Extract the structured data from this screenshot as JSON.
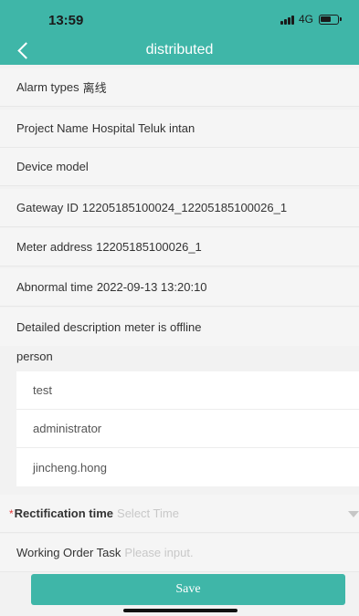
{
  "status_bar": {
    "time": "13:59",
    "network": "4G"
  },
  "header": {
    "title": "distributed"
  },
  "info": [
    {
      "label": "Alarm types",
      "value": "离线"
    },
    {
      "label": "Project Name",
      "value": "Hospital Teluk intan"
    },
    {
      "label": "Device model",
      "value": ""
    },
    {
      "label": "Gateway ID",
      "value": "12205185100024_12205185100026_1"
    },
    {
      "label": "Meter address",
      "value": "12205185100026_1"
    },
    {
      "label": "Abnormal time",
      "value": "2022-09-13 13:20:10"
    },
    {
      "label": "Detailed description",
      "value": "meter is offline"
    }
  ],
  "person": {
    "label": "person",
    "items": [
      "test",
      "administrator",
      "jincheng.hong"
    ]
  },
  "rectification": {
    "required_mark": "*",
    "label": "Rectification time",
    "placeholder": "Select Time"
  },
  "work_order": {
    "label": "Working Order Task",
    "placeholder": "Please input."
  },
  "actions": {
    "save_label": "Save"
  },
  "colors": {
    "accent": "#3fb6a8",
    "required": "#e63a3a"
  }
}
